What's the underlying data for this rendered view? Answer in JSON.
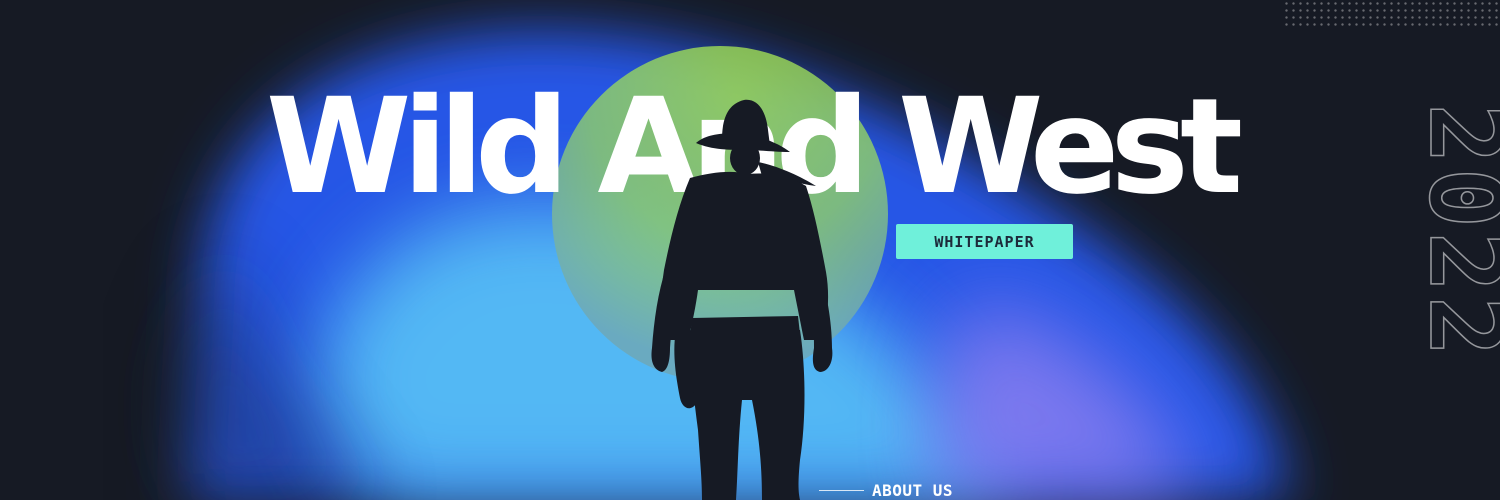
{
  "hero": {
    "title": "Wild And West",
    "year": "2022"
  },
  "buttons": {
    "whitepaper": "WHITEPAPER"
  },
  "nav": {
    "about": "ABOUT US"
  },
  "colors": {
    "background": "#161a24",
    "blob_blue": "#2f5ee6",
    "blob_light_blue": "#52bff5",
    "sun_green": "#a4e14a",
    "button_mint": "#6ff0da",
    "silhouette": "#161a24",
    "text": "#ffffff"
  },
  "icons": {
    "hero_figure": "cowboy-silhouette",
    "backdrop": "gradient-blob"
  }
}
